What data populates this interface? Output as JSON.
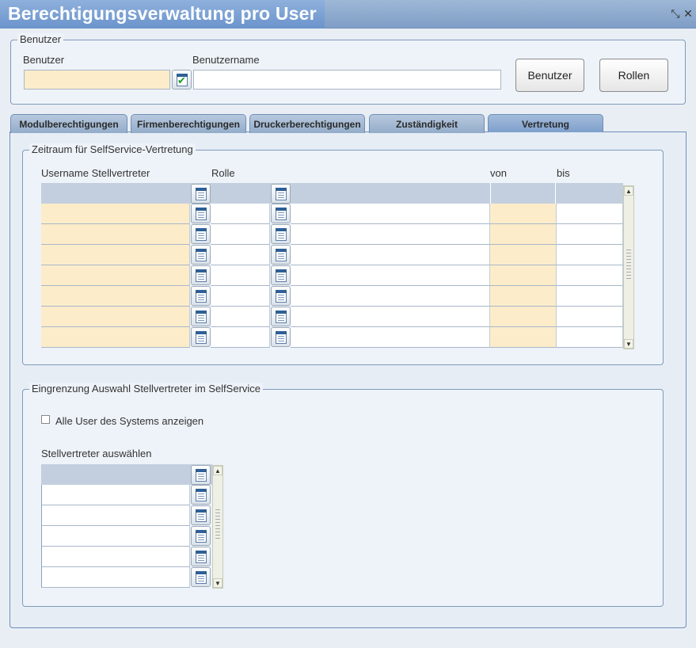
{
  "window": {
    "title": "Berechtigungsverwaltung pro User",
    "controls": [
      "restore-icon",
      "close-icon"
    ]
  },
  "user_group": {
    "legend": "Benutzer",
    "benutzer_label": "Benutzer",
    "benutzer_value": "",
    "benutzername_label": "Benutzername",
    "benutzername_value": "",
    "benutzer_button": "Benutzer",
    "rollen_button": "Rollen"
  },
  "tabs": [
    {
      "label": "Modulberechtigungen",
      "active": false
    },
    {
      "label": "Firmenberechtigungen",
      "active": false
    },
    {
      "label": "Druckerberechtigungen",
      "active": false
    },
    {
      "label": "Zuständigkeit",
      "active": false
    },
    {
      "label": "Vertretung",
      "active": true
    }
  ],
  "vertretung_group": {
    "legend": "Zeitraum für SelfService-Vertretung",
    "columns": [
      "Username Stellvertreter",
      "Rolle",
      "von",
      "bis"
    ],
    "rows": 7
  },
  "eingrenzung_group": {
    "legend": "Eingrenzung Auswahl Stellvertreter im SelfService",
    "checkbox_label": "Alle User des Systems anzeigen",
    "checkbox_checked": false,
    "list_label": "Stellvertreter auswählen",
    "rows": 5
  },
  "colors": {
    "title_bar": "#7f9ec6",
    "required_field": "#fdecca",
    "grid_header": "#c3cfdf"
  }
}
